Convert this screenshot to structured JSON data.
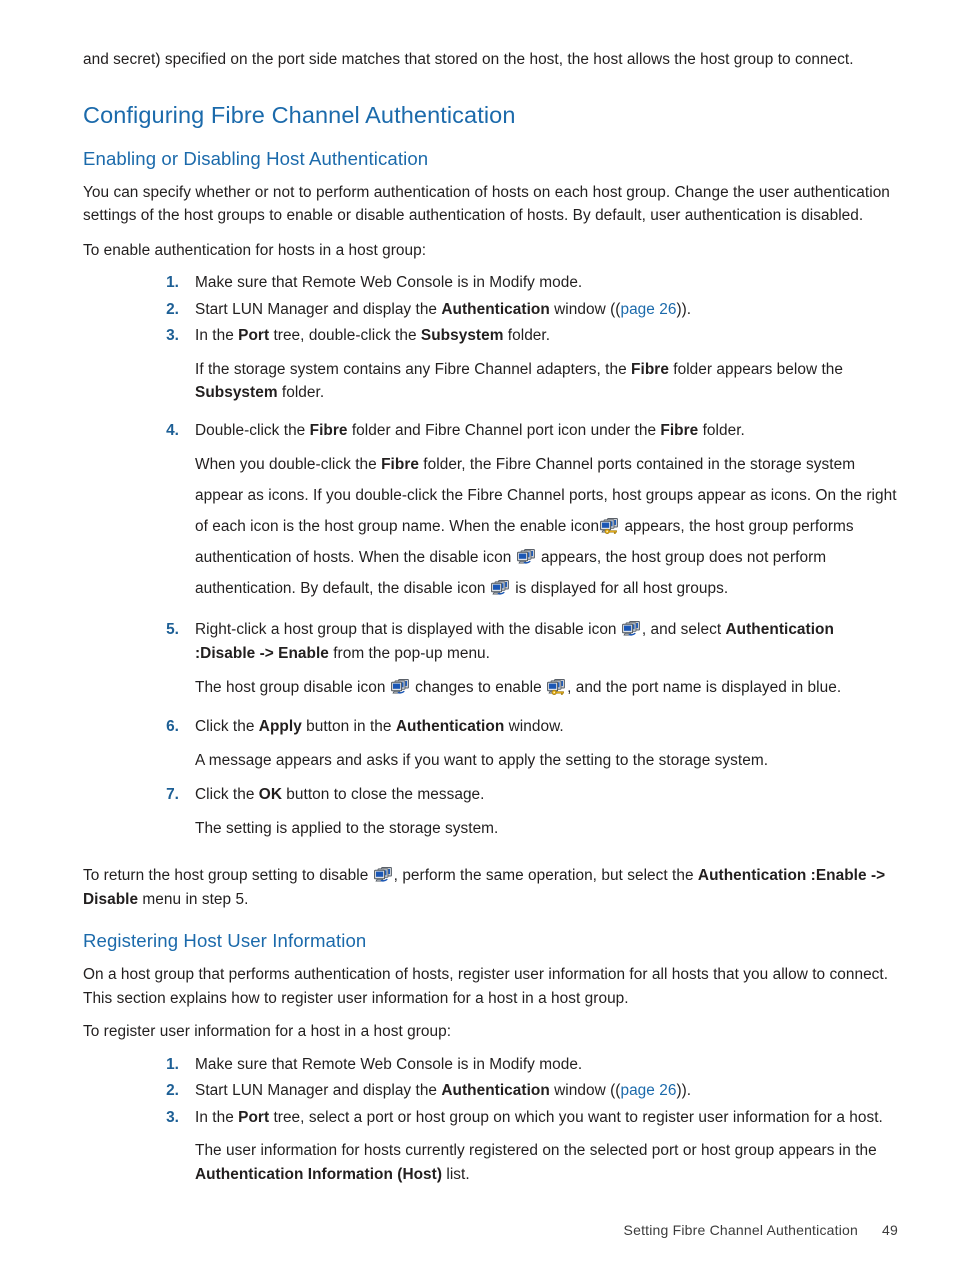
{
  "document": {
    "intro_paragraph": "and secret) specified on the port side matches that stored on the host, the host allows the host group to connect.",
    "heading_1": "Configuring Fibre Channel Authentication",
    "section_enabling": {
      "heading": "Enabling or Disabling Host Authentication",
      "paragraph_1": "You can specify whether or not to perform authentication of hosts on each host group. Change the user authentication settings of the host groups to enable or disable authentication of hosts. By default, user authentication is disabled.",
      "paragraph_2": "To enable authentication for hosts in a host group:",
      "steps": {
        "s1_num": "1.",
        "s1_text": "Make sure that Remote Web Console is in Modify mode.",
        "s2_num": "2.",
        "s2_a": "Start LUN Manager and display the ",
        "s2_b": "Authentication",
        "s2_c": " window ((",
        "s2_link": "page 26",
        "s2_d": ")).",
        "s3_num": "3.",
        "s3_a": "In the ",
        "s3_b": "Port",
        "s3_c": " tree, double-click the ",
        "s3_d": "Subsystem",
        "s3_e": " folder.",
        "s3_sub_a": "If the storage system contains any Fibre Channel adapters, the ",
        "s3_sub_b": "Fibre",
        "s3_sub_c": " folder appears below the ",
        "s3_sub_d": "Subsystem",
        "s3_sub_e": " folder.",
        "s4_num": "4.",
        "s4_a": "Double-click the ",
        "s4_b": "Fibre",
        "s4_c": " folder and Fibre Channel port icon under the ",
        "s4_d": "Fibre",
        "s4_e": " folder.",
        "s4_sub_1a": "When you double-click the ",
        "s4_sub_1b": "Fibre",
        "s4_sub_1c": " folder, the Fibre Channel ports contained in the storage system appear as icons. If you double-click the Fibre Channel ports, host groups appear as icons. On the right of each icon is the host group name. When the enable icon",
        "s4_sub_1d": " appears, the host group performs authentication of hosts. When the disable icon ",
        "s4_sub_1e": " appears, the host group does not perform authentication. By default, the disable icon ",
        "s4_sub_1f": " is displayed for all host groups.",
        "s5_num": "5.",
        "s5_a": "Right-click a host group that is displayed with the disable icon ",
        "s5_b": ", and select ",
        "s5_c": "Authentication :Disable -> Enable",
        "s5_d": " from the pop-up menu.",
        "s5_sub_a": "The host group disable icon ",
        "s5_sub_b": " changes to enable ",
        "s5_sub_c": ", and the port name is displayed in blue.",
        "s6_num": "6.",
        "s6_a": "Click the ",
        "s6_b": "Apply",
        "s6_c": " button in the ",
        "s6_d": "Authentication",
        "s6_e": " window.",
        "s6_sub": "A message appears and asks if you want to apply the setting to the storage system.",
        "s7_num": "7.",
        "s7_a": "Click the ",
        "s7_b": "OK",
        "s7_c": " button to close the message.",
        "s7_sub": "The setting is applied to the storage system."
      },
      "closing_a": "To return the host group setting to disable ",
      "closing_b": ", perform the same operation, but select the ",
      "closing_c": "Authentication :Enable -> Disable",
      "closing_d": " menu in step 5."
    },
    "section_registering": {
      "heading": "Registering Host User Information",
      "paragraph_1": "On a host group that performs authentication of hosts, register user information for all hosts that you allow to connect. This section explains how to register user information for a host in a host group.",
      "paragraph_2": "To register user information for a host in a host group:",
      "steps": {
        "r1_num": "1.",
        "r1_text": "Make sure that Remote Web Console is in Modify mode.",
        "r2_num": "2.",
        "r2_a": "Start LUN Manager and display the ",
        "r2_b": "Authentication",
        "r2_c": " window ((",
        "r2_link": "page 26",
        "r2_d": ")).",
        "r3_num": "3.",
        "r3_a": "In the ",
        "r3_b": "Port",
        "r3_c": " tree, select a port or host group on which you want to register user information for a host.",
        "r3_sub_a": "The user information for hosts currently registered on the selected port or host group appears in the ",
        "r3_sub_b": "Authentication Information (Host)",
        "r3_sub_c": " list."
      }
    },
    "footer": {
      "title": "Setting Fibre Channel Authentication",
      "page_number": "49"
    },
    "colors": {
      "heading_blue": "#1b6aab",
      "step_number_blue": "#1d5f95",
      "link_blue": "#1b6aab",
      "body_text": "#221f1f",
      "page_background": "#ffffff",
      "icon_body_blue": "#1f5fbf",
      "icon_shell_gray": "#9aa3ab",
      "icon_key_gold": "#e0a61a"
    },
    "icons": {
      "disable_icon_name": "host-group-disable-icon",
      "enable_icon_name": "host-group-enable-icon"
    }
  }
}
